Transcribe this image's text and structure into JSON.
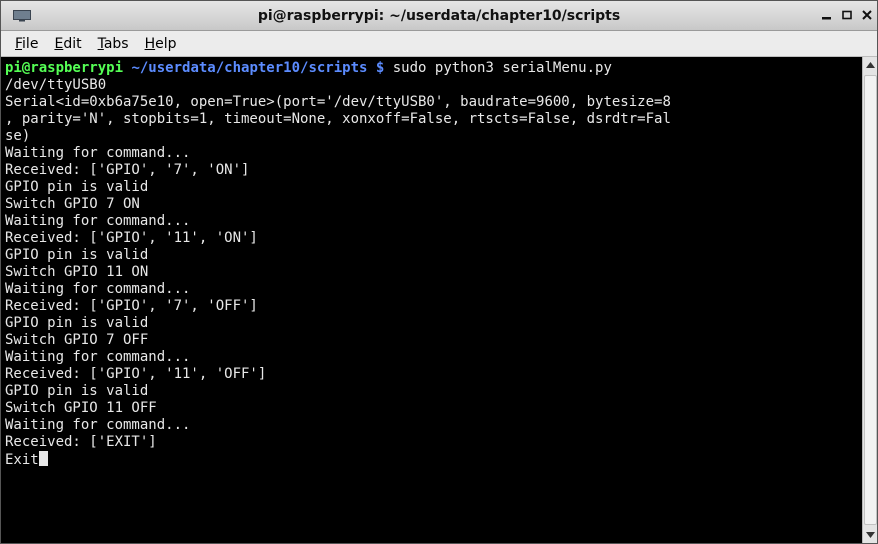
{
  "window": {
    "title": "pi@raspberrypi: ~/userdata/chapter10/scripts",
    "minimize_glyph": "▁",
    "maximize_glyph": "□",
    "close_glyph": "✕"
  },
  "menu": {
    "items": [
      {
        "mnemonic": "F",
        "rest": "ile"
      },
      {
        "mnemonic": "E",
        "rest": "dit"
      },
      {
        "mnemonic": "T",
        "rest": "abs"
      },
      {
        "mnemonic": "H",
        "rest": "elp"
      }
    ]
  },
  "terminal": {
    "prompt_user": "pi@raspberrypi",
    "prompt_path": " ~/userdata/chapter10/scripts $",
    "command": " sudo python3 serialMenu.py",
    "lines": [
      "/dev/ttyUSB0",
      "Serial<id=0xb6a75e10, open=True>(port='/dev/ttyUSB0', baudrate=9600, bytesize=8",
      ", parity='N', stopbits=1, timeout=None, xonxoff=False, rtscts=False, dsrdtr=Fal",
      "se)",
      "Waiting for command...",
      "Received: ['GPIO', '7', 'ON']",
      "GPIO pin is valid",
      "Switch GPIO 7 ON",
      "Waiting for command...",
      "Received: ['GPIO', '11', 'ON']",
      "GPIO pin is valid",
      "Switch GPIO 11 ON",
      "Waiting for command...",
      "Received: ['GPIO', '7', 'OFF']",
      "GPIO pin is valid",
      "Switch GPIO 7 OFF",
      "Waiting for command...",
      "Received: ['GPIO', '11', 'OFF']",
      "GPIO pin is valid",
      "Switch GPIO 11 OFF",
      "Waiting for command...",
      "Received: ['EXIT']"
    ],
    "last_line": "Exit"
  },
  "colors": {
    "background": "#000000",
    "text": "#e8e8e8",
    "prompt_user": "#55ff55",
    "prompt_path": "#5c8cff"
  },
  "icons": {
    "window": "terminal-app-icon",
    "scroll_up": "scroll-up-arrow-icon",
    "scroll_down": "scroll-down-arrow-icon"
  }
}
